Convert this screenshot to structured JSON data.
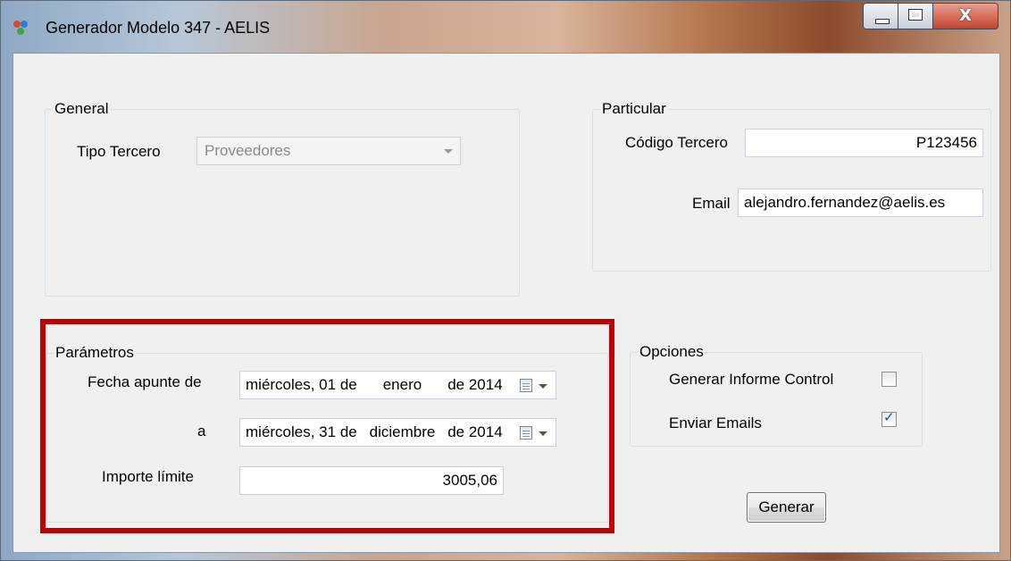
{
  "window": {
    "title": "Generador Modelo 347 - AELIS",
    "controls": {
      "minimize": "minimize",
      "maximize": "maximize",
      "close": "X"
    }
  },
  "general": {
    "legend": "General",
    "tipo_tercero_label": "Tipo Tercero",
    "tipo_tercero_value": "Proveedores"
  },
  "particular": {
    "legend": "Particular",
    "codigo_label": "Código Tercero",
    "codigo_value": "P123456",
    "email_label": "Email",
    "email_value": "alejandro.fernandez@aelis.es"
  },
  "parametros": {
    "legend": "Parámetros",
    "fecha_desde_label": "Fecha apunte de",
    "fecha_desde": {
      "weekday": "miércoles, 01 de",
      "month": "enero",
      "year": "de 2014"
    },
    "fecha_hasta_label": "a",
    "fecha_hasta": {
      "weekday": "miércoles, 31 de",
      "month": "diciembre",
      "year": "de 2014"
    },
    "importe_label": "Importe límite",
    "importe_value": "3005,06"
  },
  "opciones": {
    "legend": "Opciones",
    "informe_label": "Generar Informe Control",
    "informe_checked": false,
    "emails_label": "Enviar Emails",
    "emails_checked": true
  },
  "actions": {
    "generar_label": "Generar"
  },
  "colors": {
    "highlight": "#c00000",
    "dialog_bg": "#f0f0f0"
  }
}
